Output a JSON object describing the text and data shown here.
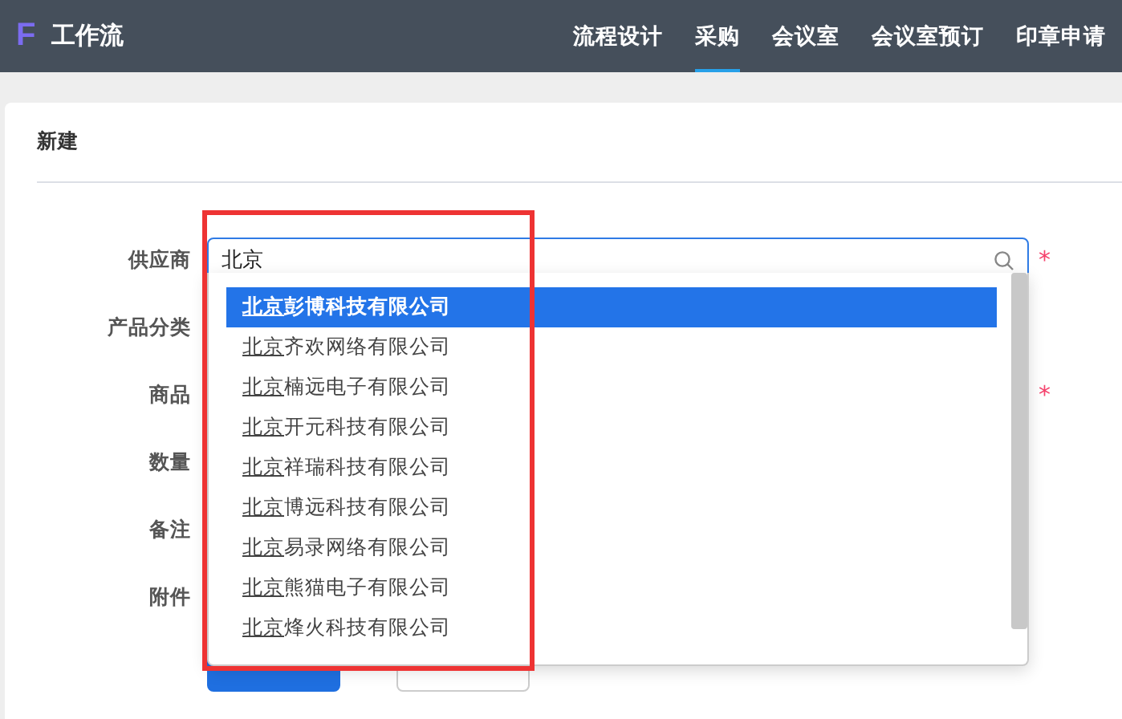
{
  "header": {
    "logo": "F",
    "title": "工作流",
    "nav": [
      {
        "label": "流程设计",
        "selected": false
      },
      {
        "label": "采购",
        "selected": true
      },
      {
        "label": "会议室",
        "selected": false
      },
      {
        "label": "会议室预订",
        "selected": false
      },
      {
        "label": "印章申请",
        "selected": false
      }
    ]
  },
  "card": {
    "title": "新建",
    "fields": [
      {
        "label": "供应商",
        "required_mark": "*",
        "value": "北京"
      },
      {
        "label": "产品分类"
      },
      {
        "label": "商品",
        "required_mark": "*"
      },
      {
        "label": "数量"
      },
      {
        "label": "备注"
      },
      {
        "label": "附件"
      }
    ]
  },
  "dropdown": {
    "options": [
      {
        "match": "北京",
        "rest": "彭博科技有限公司",
        "selected": true
      },
      {
        "match": "北京",
        "rest": "齐欢网络有限公司",
        "selected": false
      },
      {
        "match": "北京",
        "rest": "楠远电子有限公司",
        "selected": false
      },
      {
        "match": "北京",
        "rest": "开元科技有限公司",
        "selected": false
      },
      {
        "match": "北京",
        "rest": "祥瑞科技有限公司",
        "selected": false
      },
      {
        "match": "北京",
        "rest": "博远科技有限公司",
        "selected": false
      },
      {
        "match": "北京",
        "rest": "易录网络有限公司",
        "selected": false
      },
      {
        "match": "北京",
        "rest": "熊猫电子有限公司",
        "selected": false
      },
      {
        "match": "北京",
        "rest": "烽火科技有限公司",
        "selected": false
      }
    ]
  }
}
